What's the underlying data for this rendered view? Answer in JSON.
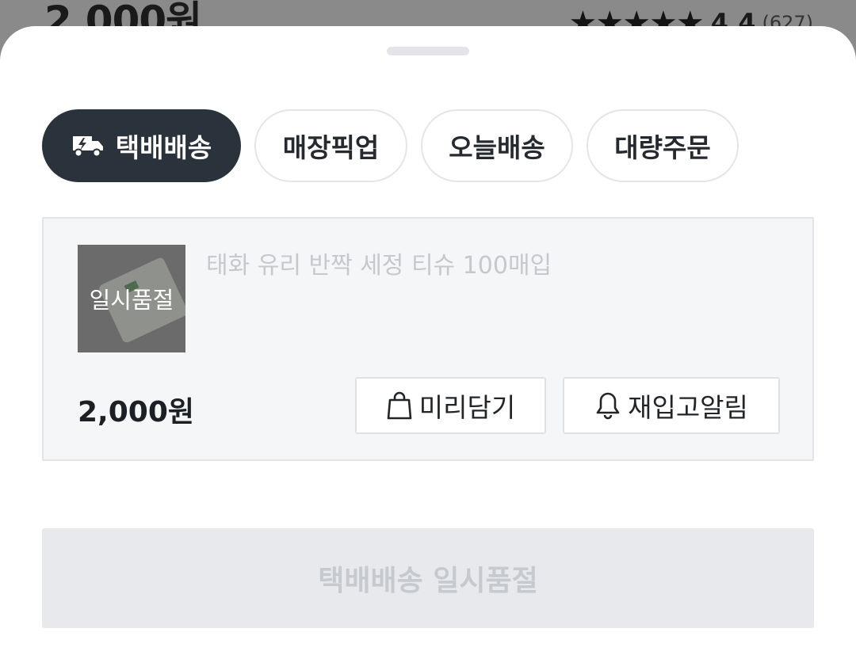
{
  "background": {
    "price": "2,000원",
    "stars": "★★★★★",
    "rating": "4.4",
    "review_count": "(627)"
  },
  "tabs": [
    {
      "label": "택배배송",
      "active": true,
      "icon": "delivery-truck-icon"
    },
    {
      "label": "매장픽업",
      "active": false
    },
    {
      "label": "오늘배송",
      "active": false
    },
    {
      "label": "대량주문",
      "active": false
    }
  ],
  "product": {
    "thumbnail_overlay": "일시품절",
    "name": "태화 유리 반짝 세정 티슈 100매입",
    "price": "2,000원",
    "preorder_button": {
      "label": "미리담기",
      "icon": "shopping-bag-icon"
    },
    "restock_button": {
      "label": "재입고알림",
      "icon": "bell-icon"
    }
  },
  "cta": {
    "label": "택배배송 일시품절"
  },
  "colors": {
    "active_tab": "#2a323b",
    "card_bg": "#f5f6f8",
    "disabled_bg": "#e8e9ec",
    "disabled_text": "#c6c9ce"
  }
}
